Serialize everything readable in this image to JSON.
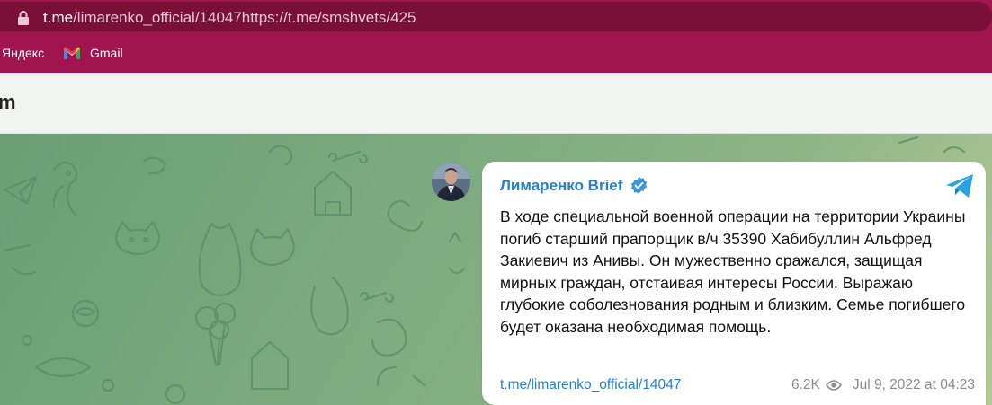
{
  "browser": {
    "url_host": "t.me",
    "url_path": "/limarenko_official/14047https://t.me/smshvets/425"
  },
  "bookmarks": {
    "items": [
      {
        "label": "Яндекс"
      },
      {
        "label": "Gmail",
        "icon": "gmail-icon"
      }
    ]
  },
  "page_header": {
    "logo_fragment": "m"
  },
  "post": {
    "author": "Лимаренко Brief",
    "verified": true,
    "text": "В ходе специальной военной операции на территории Украины погиб старший прапорщик в/ч 35390 Хабибуллин Альфред Закиевич из Анивы. Он мужественно сражался, защищая мирных граждан, отстаивая интересы России. Выражаю глубокие соболезнования родным и близким. Семье погибшего будет оказана необходимая помощь.",
    "link": "t.me/limarenko_official/14047",
    "views": "6.2K",
    "date": "Jul 9, 2022 at 04:23"
  },
  "colors": {
    "browser_bar": "#a0154d",
    "link_blue": "#2481cc",
    "chat_green": "#7aa97c"
  }
}
